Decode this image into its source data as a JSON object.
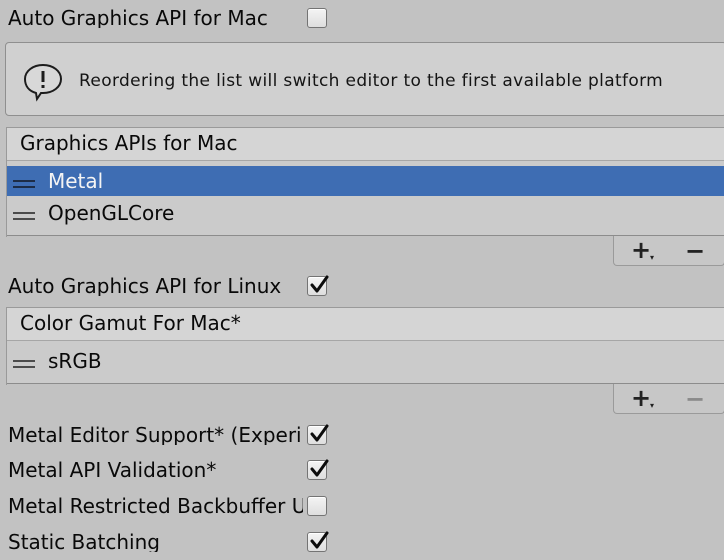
{
  "auto_graphics_mac": {
    "label": "Auto Graphics API for Mac",
    "checked": false
  },
  "help_box": {
    "icon": "info-icon",
    "text": "Reordering the list will switch editor to the first available platform"
  },
  "graphics_apis_mac": {
    "header": "Graphics APIs for Mac",
    "items": [
      {
        "label": "Metal",
        "selected": true
      },
      {
        "label": "OpenGLCore",
        "selected": false
      }
    ],
    "add_symbol": "+",
    "add_dropdown_symbol": "▾",
    "remove_symbol": "−",
    "remove_enabled": true
  },
  "auto_graphics_linux": {
    "label": "Auto Graphics API for Linux",
    "checked": true
  },
  "color_gamut_mac": {
    "header": "Color Gamut For Mac*",
    "items": [
      {
        "label": "sRGB",
        "selected": false
      }
    ],
    "add_symbol": "+",
    "add_dropdown_symbol": "▾",
    "remove_symbol": "−",
    "remove_enabled": false
  },
  "settings": [
    {
      "label": "Metal Editor Support* (Experimental)",
      "checked": true
    },
    {
      "label": "Metal API Validation*",
      "checked": true
    },
    {
      "label": "Metal Restricted Backbuffer Use",
      "checked": false
    },
    {
      "label": "Static Batching",
      "checked": true
    }
  ],
  "colors": {
    "background": "#c2c2c2",
    "selection": "#3e6db3",
    "text": "#090909"
  }
}
